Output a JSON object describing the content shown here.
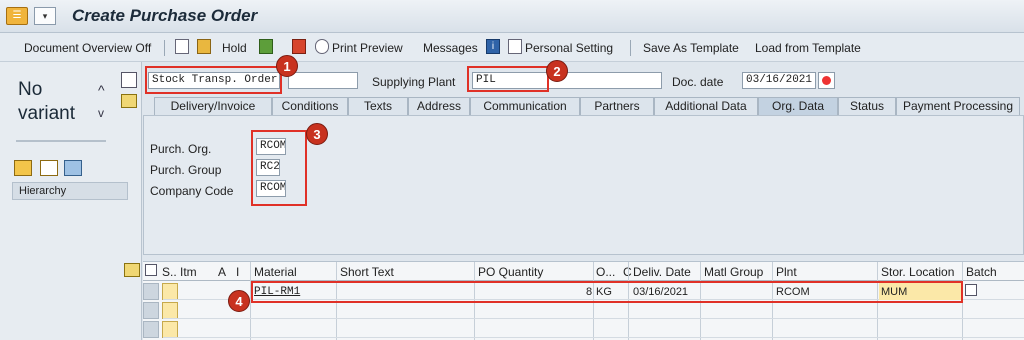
{
  "window": {
    "title": "Create Purchase Order"
  },
  "toolbar": {
    "doc_overview": "Document Overview Off",
    "hold": "Hold",
    "print_preview": "Print Preview",
    "messages": "Messages",
    "personal_setting": "Personal Setting",
    "save_as_template": "Save As Template",
    "load_from_template": "Load from Template"
  },
  "left_panel": {
    "no_variant": "No variant",
    "hierarchy": "Hierarchy"
  },
  "header": {
    "order_type": "Stock Transp. Order",
    "po_number": "",
    "supplying_plant_label": "Supplying Plant",
    "supplying_plant": "PIL",
    "doc_date_label": "Doc. date",
    "doc_date": "03/16/2021"
  },
  "tabs": [
    "Delivery/Invoice",
    "Conditions",
    "Texts",
    "Address",
    "Communication",
    "Partners",
    "Additional Data",
    "Org. Data",
    "Status",
    "Payment Processing"
  ],
  "org_data": {
    "purch_org_label": "Purch. Org.",
    "purch_org": "RCOM",
    "purch_group_label": "Purch. Group",
    "purch_group": "RC2",
    "company_code_label": "Company Code",
    "company_code": "RCOM"
  },
  "grid": {
    "columns": [
      "S..",
      "Itm",
      "A",
      "I",
      "Material",
      "Short Text",
      "PO Quantity",
      "O...",
      "C",
      "Deliv. Date",
      "Matl Group",
      "Plnt",
      "Stor. Location",
      "Batch"
    ],
    "rows": [
      {
        "material": "PIL-RM1",
        "short_text": "",
        "quantity": "8",
        "unit": "KG",
        "deliv_date": "03/16/2021",
        "matl_group": "",
        "plant": "RCOM",
        "stor_location": "MUM"
      }
    ]
  },
  "callouts": [
    "1",
    "2",
    "3",
    "4"
  ],
  "colors": {
    "callout": "#e03127",
    "badge": "#c8321f",
    "required": "#fbe8a8"
  }
}
